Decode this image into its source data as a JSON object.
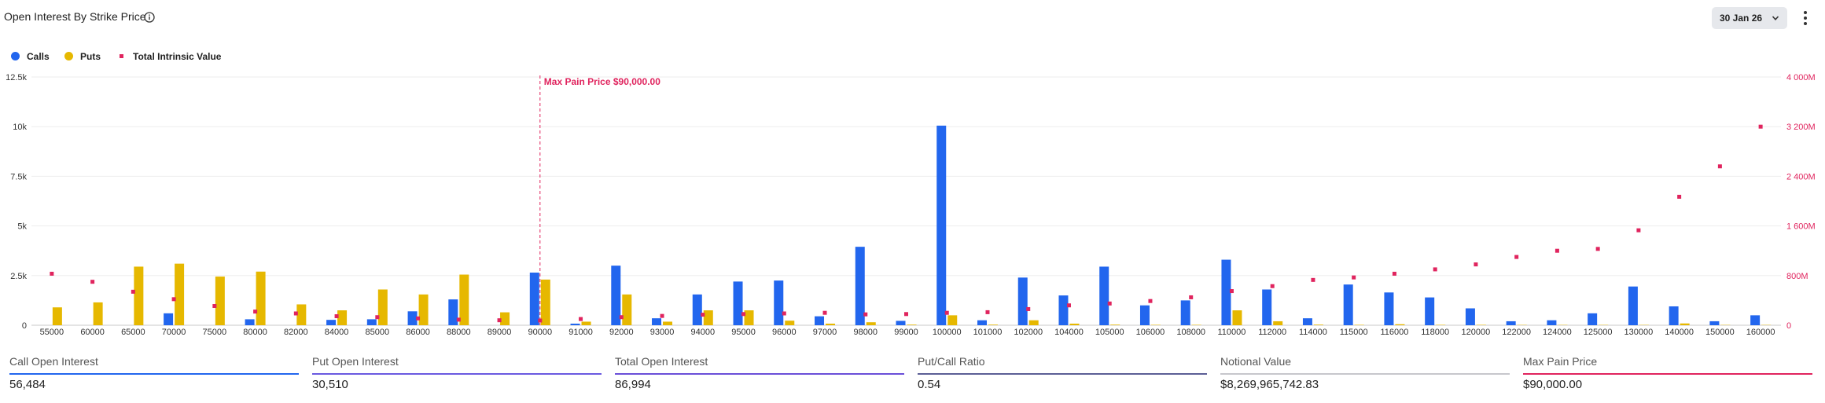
{
  "header": {
    "title": "Open Interest By Strike Price",
    "date_value": "30 Jan 26",
    "icons": {
      "info": "info-icon",
      "dropdown": "chevron-down-icon",
      "more": "more-vertical-icon"
    }
  },
  "legend": {
    "items": [
      {
        "label": "Calls",
        "color": "#2266ee",
        "shape": "dot"
      },
      {
        "label": "Puts",
        "color": "#e6b800",
        "shape": "dot"
      },
      {
        "label": "Total Intrinsic Value",
        "color": "#e0245e",
        "shape": "square"
      }
    ]
  },
  "chart_data": {
    "type": "bar",
    "categories": [
      "55000",
      "60000",
      "65000",
      "70000",
      "75000",
      "80000",
      "82000",
      "84000",
      "85000",
      "86000",
      "88000",
      "89000",
      "90000",
      "91000",
      "92000",
      "93000",
      "94000",
      "95000",
      "96000",
      "97000",
      "98000",
      "99000",
      "100000",
      "101000",
      "102000",
      "104000",
      "105000",
      "106000",
      "108000",
      "110000",
      "112000",
      "114000",
      "115000",
      "116000",
      "118000",
      "120000",
      "122000",
      "124000",
      "125000",
      "130000",
      "140000",
      "150000",
      "160000"
    ],
    "series": [
      {
        "name": "Calls",
        "axis": "left",
        "kind": "bar",
        "color": "#2266ee",
        "values": [
          0,
          0,
          0,
          600,
          0,
          300,
          0,
          270,
          300,
          700,
          1300,
          0,
          2650,
          80,
          3000,
          350,
          1550,
          2200,
          2250,
          450,
          3950,
          220,
          10050,
          250,
          2400,
          1500,
          2950,
          1000,
          1250,
          3300,
          1800,
          350,
          2050,
          1650,
          1400,
          850,
          200,
          250,
          600,
          1950,
          950,
          200,
          500
        ]
      },
      {
        "name": "Puts",
        "axis": "left",
        "kind": "bar",
        "color": "#e6b800",
        "values": [
          900,
          1150,
          2950,
          3100,
          2450,
          2700,
          1050,
          750,
          1800,
          1550,
          2550,
          650,
          2300,
          180,
          1550,
          180,
          750,
          750,
          230,
          80,
          150,
          30,
          500,
          30,
          250,
          80,
          30,
          20,
          20,
          750,
          200,
          30,
          20,
          50,
          20,
          20,
          15,
          15,
          15,
          15,
          90,
          15,
          15
        ]
      },
      {
        "name": "Total Intrinsic Value",
        "axis": "right",
        "kind": "point",
        "color": "#e0245e",
        "values": [
          830,
          700,
          540,
          420,
          310,
          220,
          190,
          145,
          130,
          110,
          90,
          80,
          75,
          100,
          130,
          150,
          170,
          180,
          190,
          200,
          175,
          180,
          200,
          210,
          260,
          320,
          350,
          390,
          450,
          550,
          630,
          730,
          770,
          830,
          900,
          980,
          1100,
          1200,
          1230,
          1530,
          2070,
          2560,
          3200
        ]
      }
    ],
    "left_axis": {
      "min": 0,
      "max": 12500,
      "ticks": [
        0,
        2500,
        5000,
        7500,
        10000,
        12500
      ],
      "tick_labels": [
        "0",
        "2.5k",
        "5k",
        "7.5k",
        "10k",
        "12.5k"
      ]
    },
    "right_axis": {
      "min": 0,
      "max": 4000,
      "ticks": [
        0,
        800,
        1600,
        2400,
        3200,
        4000
      ],
      "tick_labels": [
        "0",
        "800M",
        "1 600M",
        "2 400M",
        "3 200M",
        "4 000M"
      ],
      "color": "#e0245e"
    },
    "annotation": {
      "label": "Max Pain Price $90,000.00",
      "category": "90000",
      "color": "#e0245e"
    },
    "grid": true,
    "legend": "top-left"
  },
  "stats": [
    {
      "label": "Call Open Interest",
      "value": "56,484",
      "color": "#2266ee"
    },
    {
      "label": "Put Open Interest",
      "value": "30,510",
      "color": "#6a5ae0"
    },
    {
      "label": "Total Open Interest",
      "value": "86,994",
      "color": "#6a4fd8"
    },
    {
      "label": "Put/Call Ratio",
      "value": "0.54",
      "color": "#5c5f96"
    },
    {
      "label": "Notional Value",
      "value": "$8,269,965,742.83",
      "color": "#c7c7cc"
    },
    {
      "label": "Max Pain Price",
      "value": "$90,000.00",
      "color": "#e0245e"
    }
  ]
}
